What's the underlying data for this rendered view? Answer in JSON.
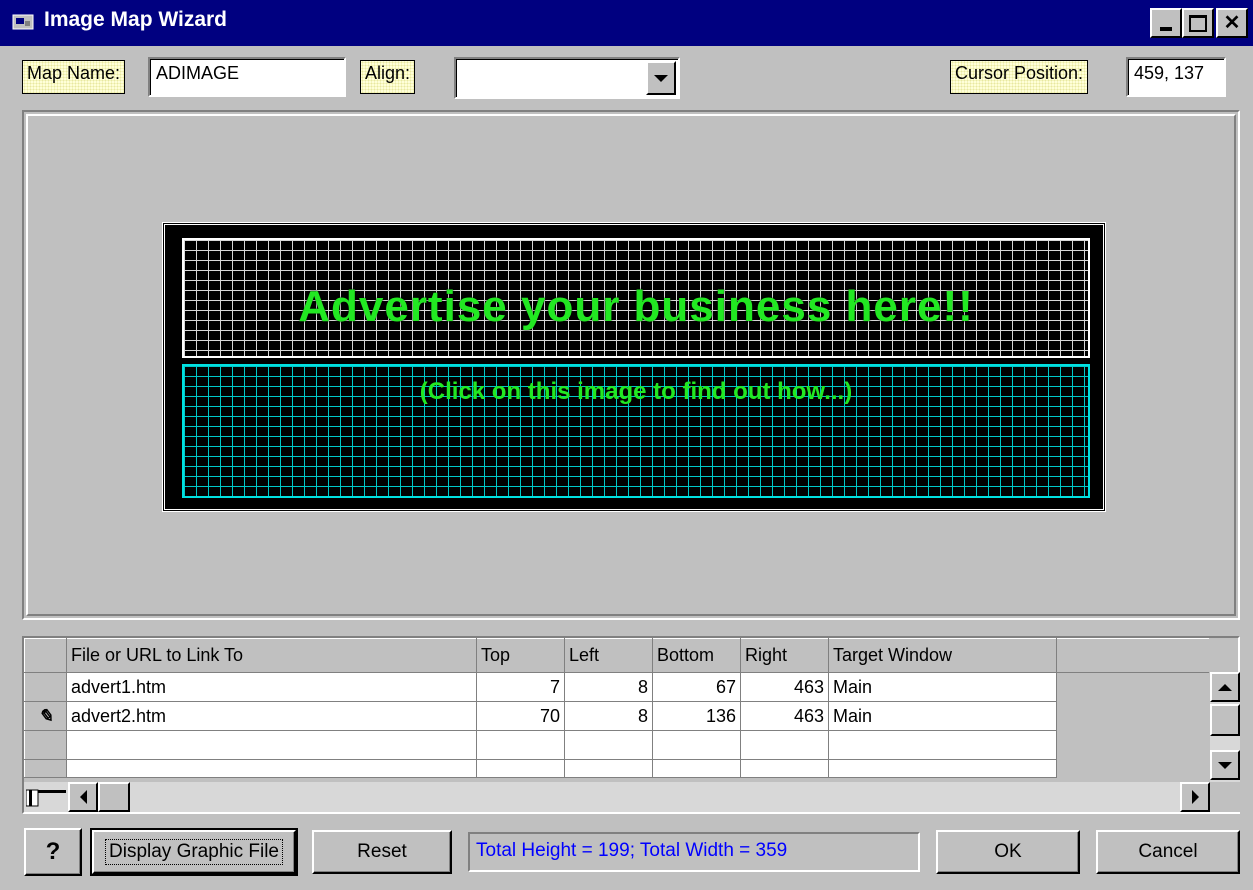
{
  "window": {
    "title": "Image Map Wizard",
    "controls": [
      "minimize",
      "maximize",
      "close"
    ]
  },
  "toolbar": {
    "map_name_label": "Map Name:",
    "map_name_value": "ADIMAGE",
    "align_label": "Align:",
    "align_value": "",
    "cursor_label": "Cursor Position:",
    "cursor_value": "459, 137"
  },
  "image": {
    "headline": "Advertise your business here!!",
    "subline": "(Click on this image to find out how...)",
    "headline_color": "#22e822",
    "area1_grid_color": "#d8d8d8",
    "area2_grid_color": "#00c8c8"
  },
  "grid": {
    "columns": [
      "File or URL to Link To",
      "Top",
      "Left",
      "Bottom",
      "Right",
      "Target Window"
    ],
    "rows": [
      {
        "file": "advert1.htm",
        "top": "7",
        "left": "8",
        "bottom": "67",
        "right": "463",
        "target": "Main"
      },
      {
        "file": "advert2.htm",
        "top": "70",
        "left": "8",
        "bottom": "136",
        "right": "463",
        "target": "Main"
      },
      {
        "file": "",
        "top": "",
        "left": "",
        "bottom": "",
        "right": "",
        "target": ""
      },
      {
        "file": "",
        "top": "",
        "left": "",
        "bottom": "",
        "right": "",
        "target": ""
      }
    ],
    "edit_row_icon": "pencil-icon"
  },
  "footer": {
    "help_label": "?",
    "display_label": "Display Graphic File",
    "reset_label": "Reset",
    "status_text": "Total Height = 199;    Total Width = 359",
    "ok_label": "OK",
    "cancel_label": "Cancel"
  }
}
